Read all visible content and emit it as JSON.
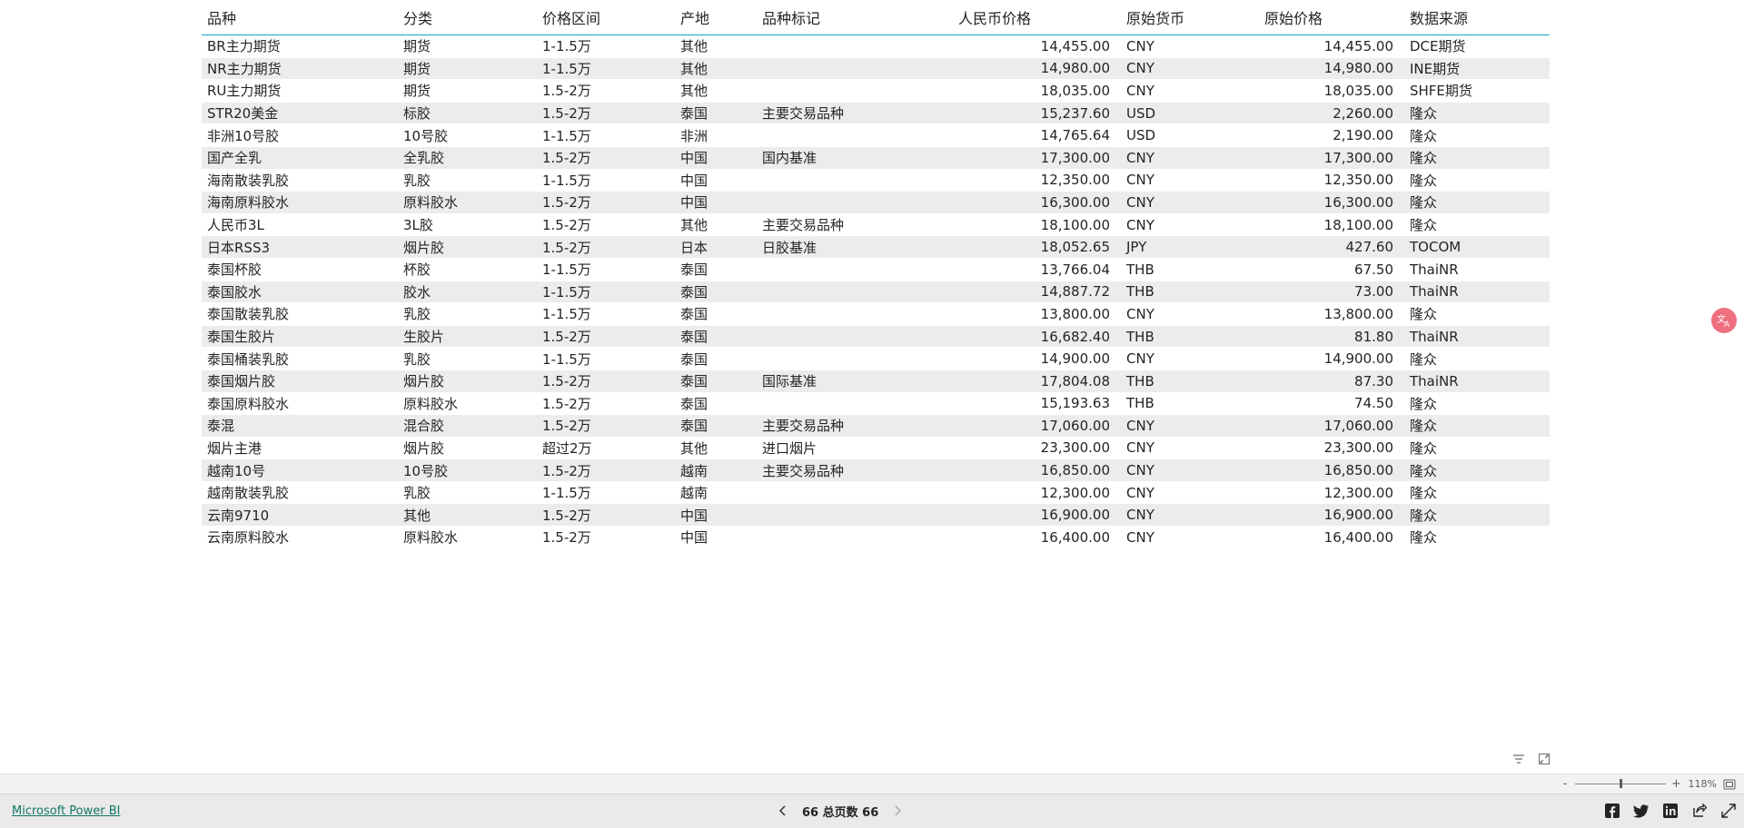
{
  "table": {
    "columns": [
      "品种",
      "分类",
      "价格区间",
      "产地",
      "品种标记",
      "人民币价格",
      "原始货币",
      "原始价格",
      "数据来源"
    ],
    "rows": [
      [
        "BR主力期货",
        "期货",
        "1-1.5万",
        "其他",
        "",
        "14,455.00",
        "CNY",
        "14,455.00",
        "DCE期货"
      ],
      [
        "NR主力期货",
        "期货",
        "1-1.5万",
        "其他",
        "",
        "14,980.00",
        "CNY",
        "14,980.00",
        "INE期货"
      ],
      [
        "RU主力期货",
        "期货",
        "1.5-2万",
        "其他",
        "",
        "18,035.00",
        "CNY",
        "18,035.00",
        "SHFE期货"
      ],
      [
        "STR20美金",
        "标胶",
        "1.5-2万",
        "泰国",
        "主要交易品种",
        "15,237.60",
        "USD",
        "2,260.00",
        "隆众"
      ],
      [
        "非洲10号胶",
        "10号胶",
        "1-1.5万",
        "非洲",
        "",
        "14,765.64",
        "USD",
        "2,190.00",
        "隆众"
      ],
      [
        "国产全乳",
        "全乳胶",
        "1.5-2万",
        "中国",
        "国内基准",
        "17,300.00",
        "CNY",
        "17,300.00",
        "隆众"
      ],
      [
        "海南散装乳胶",
        "乳胶",
        "1-1.5万",
        "中国",
        "",
        "12,350.00",
        "CNY",
        "12,350.00",
        "隆众"
      ],
      [
        "海南原料胶水",
        "原料胶水",
        "1.5-2万",
        "中国",
        "",
        "16,300.00",
        "CNY",
        "16,300.00",
        "隆众"
      ],
      [
        "人民币3L",
        "3L胶",
        "1.5-2万",
        "其他",
        "主要交易品种",
        "18,100.00",
        "CNY",
        "18,100.00",
        "隆众"
      ],
      [
        "日本RSS3",
        "烟片胶",
        "1.5-2万",
        "日本",
        "日胶基准",
        "18,052.65",
        "JPY",
        "427.60",
        "TOCOM"
      ],
      [
        "泰国杯胶",
        "杯胶",
        "1-1.5万",
        "泰国",
        "",
        "13,766.04",
        "THB",
        "67.50",
        "ThaiNR"
      ],
      [
        "泰国胶水",
        "胶水",
        "1-1.5万",
        "泰国",
        "",
        "14,887.72",
        "THB",
        "73.00",
        "ThaiNR"
      ],
      [
        "泰国散装乳胶",
        "乳胶",
        "1-1.5万",
        "泰国",
        "",
        "13,800.00",
        "CNY",
        "13,800.00",
        "隆众"
      ],
      [
        "泰国生胶片",
        "生胶片",
        "1.5-2万",
        "泰国",
        "",
        "16,682.40",
        "THB",
        "81.80",
        "ThaiNR"
      ],
      [
        "泰国桶装乳胶",
        "乳胶",
        "1-1.5万",
        "泰国",
        "",
        "14,900.00",
        "CNY",
        "14,900.00",
        "隆众"
      ],
      [
        "泰国烟片胶",
        "烟片胶",
        "1.5-2万",
        "泰国",
        "国际基准",
        "17,804.08",
        "THB",
        "87.30",
        "ThaiNR"
      ],
      [
        "泰国原料胶水",
        "原料胶水",
        "1.5-2万",
        "泰国",
        "",
        "15,193.63",
        "THB",
        "74.50",
        "隆众"
      ],
      [
        "泰混",
        "混合胶",
        "1.5-2万",
        "泰国",
        "主要交易品种",
        "17,060.00",
        "CNY",
        "17,060.00",
        "隆众"
      ],
      [
        "烟片主港",
        "烟片胶",
        "超过2万",
        "其他",
        "进口烟片",
        "23,300.00",
        "CNY",
        "23,300.00",
        "隆众"
      ],
      [
        "越南10号",
        "10号胶",
        "1.5-2万",
        "越南",
        "主要交易品种",
        "16,850.00",
        "CNY",
        "16,850.00",
        "隆众"
      ],
      [
        "越南散装乳胶",
        "乳胶",
        "1-1.5万",
        "越南",
        "",
        "12,300.00",
        "CNY",
        "12,300.00",
        "隆众"
      ],
      [
        "云南9710",
        "其他",
        "1.5-2万",
        "中国",
        "",
        "16,900.00",
        "CNY",
        "16,900.00",
        "隆众"
      ],
      [
        "云南原料胶水",
        "原料胶水",
        "1.5-2万",
        "中国",
        "",
        "16,400.00",
        "CNY",
        "16,400.00",
        "隆众"
      ]
    ]
  },
  "visual_header": {
    "icons": [
      "filter-icon",
      "focus-mode-icon"
    ]
  },
  "zoom": {
    "minus": "-",
    "plus": "+",
    "level_text": "118%",
    "level_fraction": 0.5
  },
  "footer": {
    "brand_link": "Microsoft Power BI",
    "pager_text": "66 总页数 66",
    "share_icons": [
      "facebook-icon",
      "twitter-icon",
      "linkedin-icon",
      "share-icon",
      "fullscreen-icon"
    ]
  },
  "accent_colors": {
    "header_rule": "#15a2c4",
    "brand_link": "#117865",
    "translate_badge": "#ee6f7e"
  }
}
